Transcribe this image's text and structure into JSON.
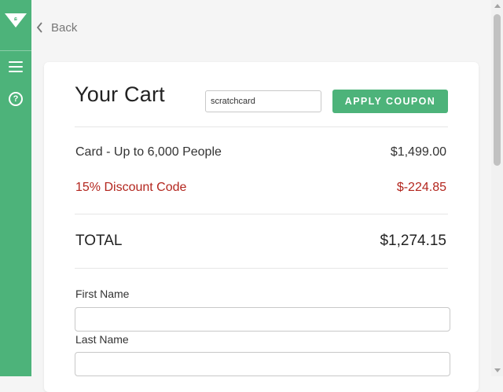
{
  "nav": {
    "back_label": "Back"
  },
  "cart": {
    "title": "Your Cart",
    "coupon_value": "scratchcard",
    "apply_label": "APPLY COUPON",
    "items": [
      {
        "label": "Card - Up to 6,000 People",
        "amount": "$1,499.00"
      },
      {
        "label": "15% Discount Code",
        "amount": "$-224.85"
      }
    ],
    "total_label": "TOTAL",
    "total_amount": "$1,274.15"
  },
  "form": {
    "first_name_label": "First Name",
    "last_name_label": "Last Name"
  },
  "colors": {
    "brand": "#4db37a",
    "discount": "#b3261e",
    "background": "#f5f5f5"
  },
  "icons": {
    "logo": "logo-icon",
    "menu": "hamburger-menu-icon",
    "help": "help-icon",
    "back": "chevron-left-icon"
  }
}
